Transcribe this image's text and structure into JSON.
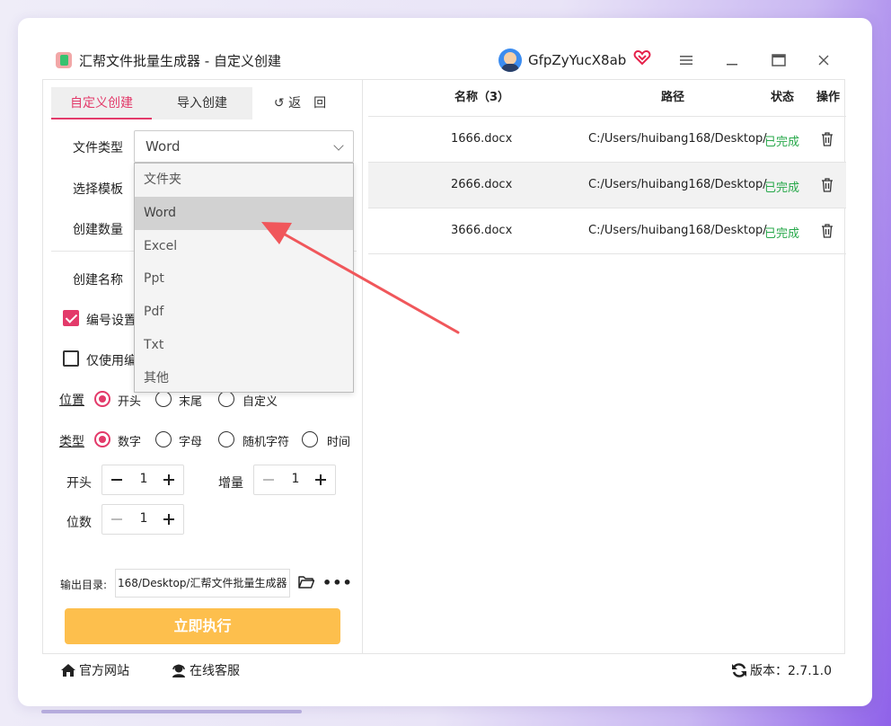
{
  "window": {
    "title": "汇帮文件批量生成器 - 自定义创建",
    "username": "GfpZyYucX8ab"
  },
  "tabs": {
    "custom": "自定义创建",
    "import": "导入创建",
    "back": "↺ 返　回"
  },
  "form": {
    "file_type_label": "文件类型",
    "file_type_value": "Word",
    "template_label": "选择模板",
    "count_label": "创建数量",
    "name_label": "创建名称",
    "numbering_label": "编号设置",
    "only_number_label": "仅使用编",
    "position_label": "位置",
    "position_options": [
      "开头",
      "末尾",
      "自定义"
    ],
    "type_label": "类型",
    "type_options": [
      "数字",
      "字母",
      "随机字符",
      "时间"
    ],
    "start_label": "开头",
    "start_value": "1",
    "increment_label": "增量",
    "increment_value": "1",
    "digits_label": "位数",
    "digits_value": "1",
    "output_label": "输出目录:",
    "output_value": "168/Desktop/汇帮文件批量生成器",
    "execute_label": "立即执行"
  },
  "dropdown": {
    "options": [
      "文件夹",
      "Word",
      "Excel",
      "Ppt",
      "Pdf",
      "Txt",
      "其他"
    ],
    "hovered": "Word"
  },
  "table": {
    "headers": {
      "name": "名称（3）",
      "path": "路径",
      "status": "状态",
      "action": "操作"
    },
    "rows": [
      {
        "name": "1666.docx",
        "path": "C:/Users/huibang168/Desktop/",
        "status": "已完成"
      },
      {
        "name": "2666.docx",
        "path": "C:/Users/huibang168/Desktop/",
        "status": "已完成"
      },
      {
        "name": "3666.docx",
        "path": "C:/Users/huibang168/Desktop/",
        "status": "已完成"
      }
    ]
  },
  "footer": {
    "website": "官方网站",
    "support": "在线客服",
    "version": "版本：2.7.1.0"
  },
  "colors": {
    "accent": "#e33a6a",
    "execute": "#fdbf4d",
    "status_done": "#27a84a"
  },
  "icons": [
    "app-icon",
    "avatar",
    "vip-heart-icon",
    "menu-icon",
    "minimize-icon",
    "maximize-icon",
    "close-icon",
    "chevron-down-icon",
    "folder-icon",
    "more-icon",
    "trash-icon",
    "home-icon",
    "headset-icon",
    "refresh-icon"
  ]
}
